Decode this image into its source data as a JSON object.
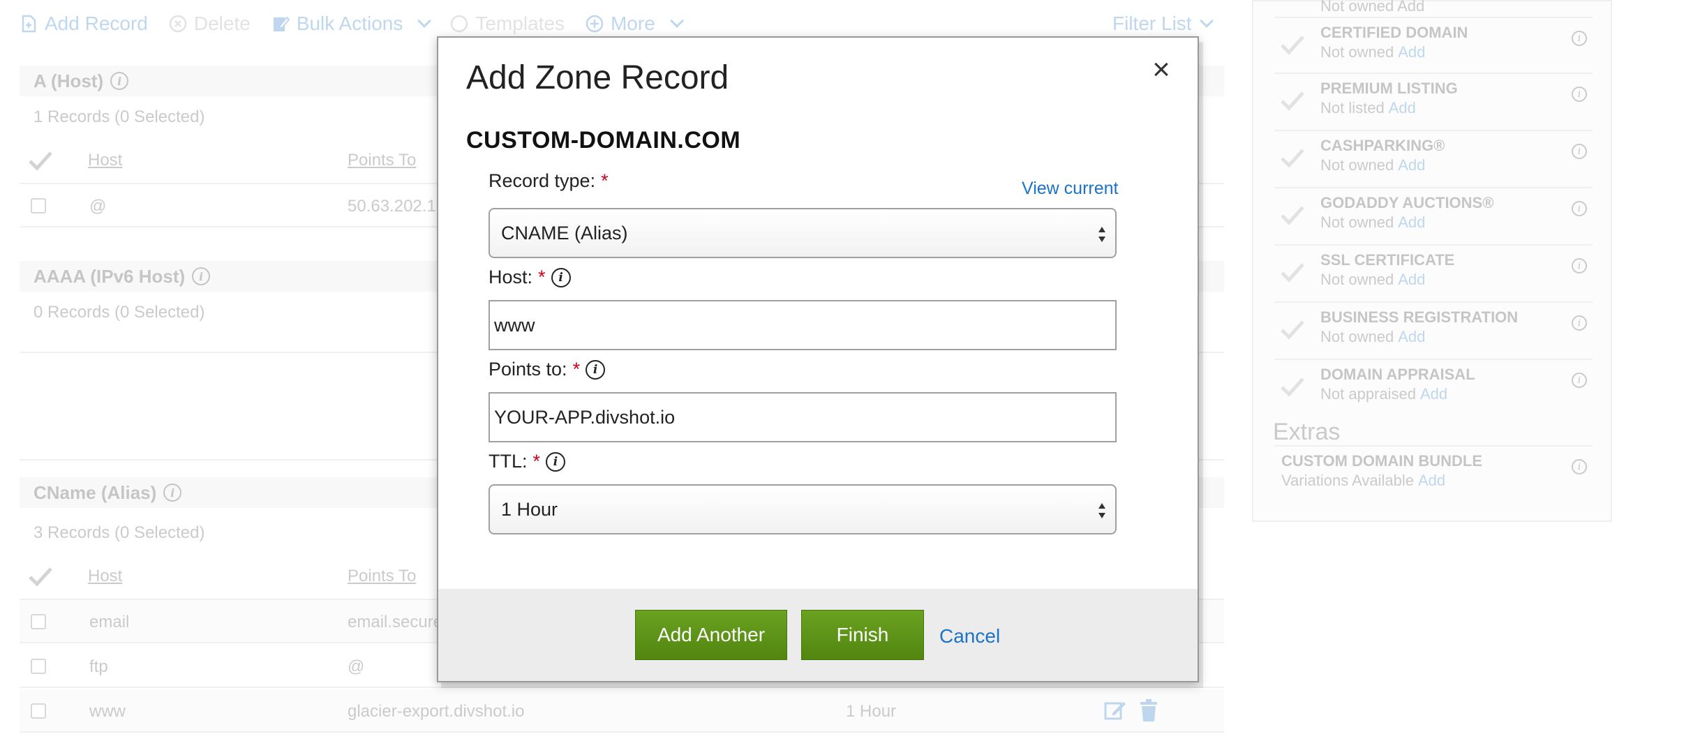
{
  "toolbar": {
    "add_record": "Add Record",
    "delete": "Delete",
    "bulk_actions": "Bulk Actions",
    "templates": "Templates",
    "more": "More",
    "filter_list": "Filter List"
  },
  "sections": {
    "a": {
      "title": "A (Host)",
      "count": "1 Records (0 Selected)"
    },
    "aaaa": {
      "title": "AAAA (IPv6 Host)",
      "count": "0 Records (0 Selected)"
    },
    "cname": {
      "title": "CName (Alias)",
      "count": "3 Records (0 Selected)"
    }
  },
  "columns": {
    "host": "Host",
    "points_to": "Points To"
  },
  "a_rows": [
    {
      "host": "@",
      "points_to": "50.63.202.1"
    }
  ],
  "cname_rows": [
    {
      "host": "email",
      "points_to": "email.secure",
      "ttl": ""
    },
    {
      "host": "ftp",
      "points_to": "@",
      "ttl": ""
    },
    {
      "host": "www",
      "points_to": "glacier-export.divshot.io",
      "ttl": "1 Hour"
    }
  ],
  "panel": {
    "top_partial": "Not owned  Add",
    "items": [
      {
        "title": "CERTIFIED DOMAIN",
        "status": "Not owned",
        "action": "Add"
      },
      {
        "title": "PREMIUM LISTING",
        "status": "Not listed",
        "action": "Add"
      },
      {
        "title": "CASHPARKING®",
        "status": "Not owned",
        "action": "Add"
      },
      {
        "title": "GODADDY AUCTIONS®",
        "status": "Not owned",
        "action": "Add"
      },
      {
        "title": "SSL CERTIFICATE",
        "status": "Not owned",
        "action": "Add"
      },
      {
        "title": "BUSINESS REGISTRATION",
        "status": "Not owned",
        "action": "Add"
      },
      {
        "title": "DOMAIN APPRAISAL",
        "status": "Not appraised",
        "action": "Add"
      }
    ],
    "extras_title": "Extras",
    "extras": [
      {
        "title": "CUSTOM DOMAIN BUNDLE",
        "status": "Variations Available",
        "action": "Add"
      }
    ]
  },
  "modal": {
    "title": "Add Zone Record",
    "close": "×",
    "domain": "CUSTOM-DOMAIN.COM",
    "record_type_label": "Record type:",
    "view_current": "View current",
    "record_type_value": "CNAME (Alias)",
    "host_label": "Host:",
    "host_value": "www",
    "points_to_label": "Points to:",
    "points_to_value": "YOUR-APP.divshot.io",
    "ttl_label": "TTL:",
    "ttl_value": "1 Hour",
    "required_mark": "*",
    "info_glyph": "i",
    "add_another": "Add Another",
    "finish": "Finish",
    "cancel": "Cancel"
  },
  "colors": {
    "accent_link": "#1a73c9",
    "button_green": "#5e9619",
    "required": "#d0021b"
  }
}
